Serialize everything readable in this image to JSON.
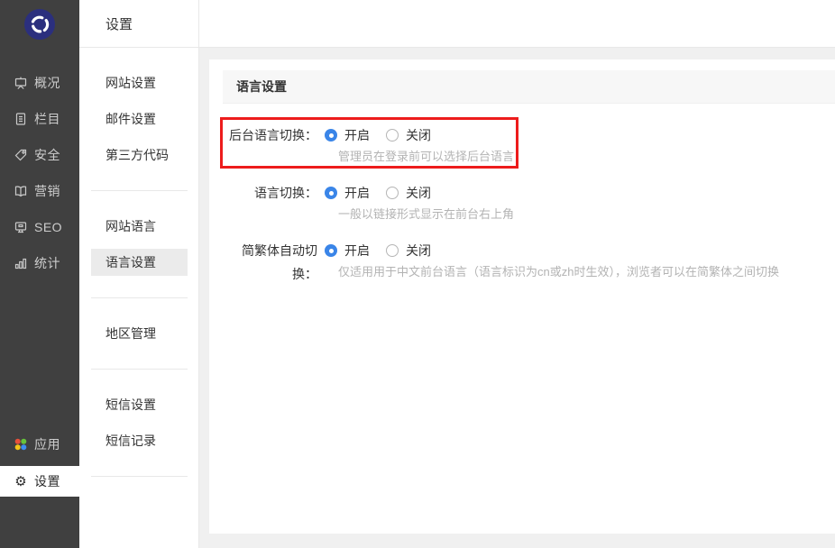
{
  "colors": {
    "sidebar_bg": "#404040",
    "sidebar_text": "#cdcdcd",
    "accent_blue": "#3a85e8",
    "annotation_red": "#ed1c1c",
    "active_submenu_bg": "#ebebeb",
    "panel_header_bg": "#f7f7f7",
    "hint_text": "#b3b3b3",
    "logo_navy": "#2b2f7e"
  },
  "sidebar": {
    "logo_icon": "swirl-logo",
    "items": [
      {
        "label": "概况",
        "icon": "overview-board-icon"
      },
      {
        "label": "栏目",
        "icon": "columns-doc-icon"
      },
      {
        "label": "安全",
        "icon": "security-tag-icon"
      },
      {
        "label": "营销",
        "icon": "marketing-book-icon"
      },
      {
        "label": "SEO",
        "icon": "seo-monitor-icon"
      },
      {
        "label": "统计",
        "icon": "stats-bars-icon"
      }
    ],
    "bottom_items": [
      {
        "label": "应用",
        "icon": "apps-clover-icon",
        "active": false
      },
      {
        "label": "设置",
        "icon": "gear-icon",
        "active": true
      }
    ]
  },
  "topbar": {
    "title": "设置"
  },
  "submenu": {
    "groups": [
      {
        "items": [
          "网站设置",
          "邮件设置",
          "第三方代码"
        ]
      },
      {
        "items": [
          "网站语言",
          "语言设置"
        ],
        "active_item": "语言设置"
      },
      {
        "items": [
          "地区管理"
        ]
      },
      {
        "items": [
          "短信设置",
          "短信记录"
        ]
      }
    ]
  },
  "main": {
    "panel_title": "语言设置",
    "rows": [
      {
        "label": "后台语言切换：",
        "on_label": "开启",
        "off_label": "关闭",
        "selected": "on",
        "hint": "管理员在登录前可以选择后台语言",
        "annotated": true
      },
      {
        "label": "语言切换：",
        "on_label": "开启",
        "off_label": "关闭",
        "selected": "on",
        "hint": "一般以链接形式显示在前台右上角"
      },
      {
        "label": "简繁体自动切换：",
        "on_label": "开启",
        "off_label": "关闭",
        "selected": "on",
        "hint": "仅适用用于中文前台语言（语言标识为cn或zh时生效），浏览者可以在简繁体之间切换"
      }
    ]
  }
}
